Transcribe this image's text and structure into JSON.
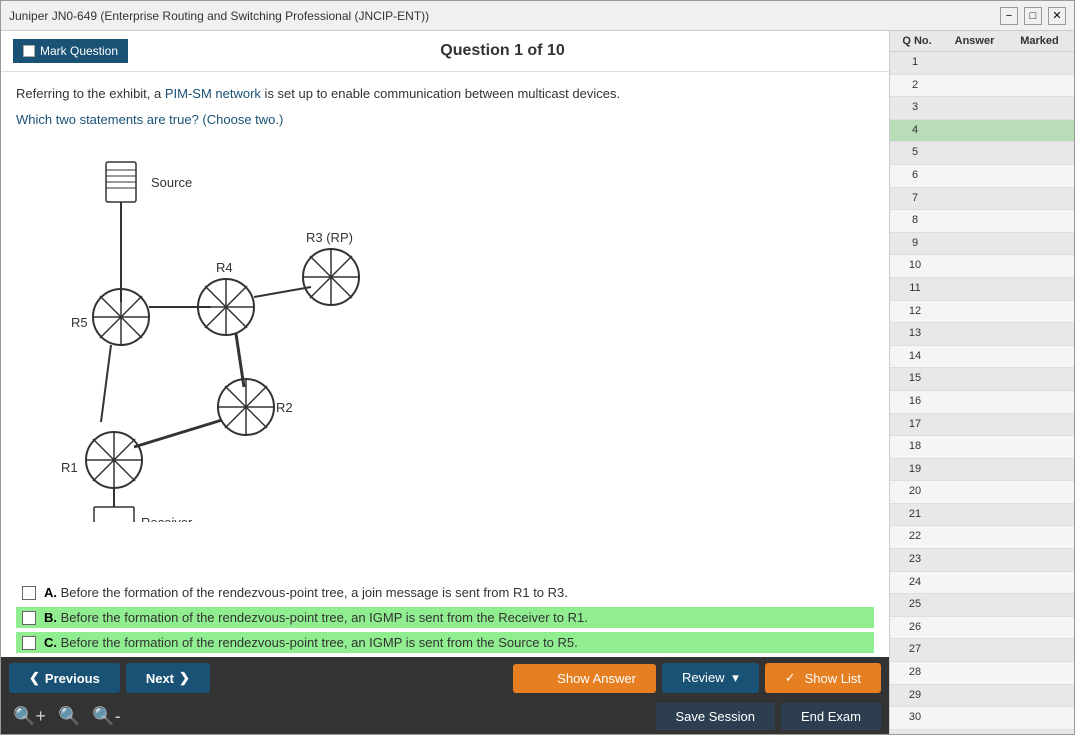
{
  "window": {
    "title": "Juniper JN0-649 (Enterprise Routing and Switching Professional (JNCIP-ENT))",
    "minimize_label": "−",
    "restore_label": "□",
    "close_label": "✕"
  },
  "header": {
    "mark_question_label": "Mark Question",
    "question_title": "Question 1 of 10"
  },
  "question": {
    "text_part1": "Referring to the exhibit, a ",
    "text_link": "PIM-SM network",
    "text_part2": " is set up to enable communication between multicast devices.",
    "choose_text": "Which two statements are true? (Choose two.)"
  },
  "answers": [
    {
      "id": "A",
      "label": "A.",
      "text": " Before the formation of the rendezvous-point tree, a join message is sent from R1 to R3.",
      "highlighted": false
    },
    {
      "id": "B",
      "label": "B.",
      "text": " Before the formation of the rendezvous-point tree, an IGMP is sent from the Receiver to R1.",
      "highlighted": true
    },
    {
      "id": "C",
      "label": "C.",
      "text": " Before the formation of the rendezvous-point tree, an IGMP is sent from the Source to R5.",
      "highlighted": true
    }
  ],
  "bottom_buttons": {
    "previous_label": "Previous",
    "next_label": "Next",
    "show_answer_label": "Show Answer",
    "review_label": "Review",
    "show_list_label": "Show List",
    "save_session_label": "Save Session",
    "end_exam_label": "End Exam"
  },
  "right_panel": {
    "col_q_no": "Q No.",
    "col_answer": "Answer",
    "col_marked": "Marked"
  },
  "questions_list": [
    {
      "num": 1,
      "answer": "",
      "marked": ""
    },
    {
      "num": 2,
      "answer": "",
      "marked": ""
    },
    {
      "num": 3,
      "answer": "",
      "marked": ""
    },
    {
      "num": 4,
      "answer": "",
      "marked": ""
    },
    {
      "num": 5,
      "answer": "",
      "marked": ""
    },
    {
      "num": 6,
      "answer": "",
      "marked": ""
    },
    {
      "num": 7,
      "answer": "",
      "marked": ""
    },
    {
      "num": 8,
      "answer": "",
      "marked": ""
    },
    {
      "num": 9,
      "answer": "",
      "marked": ""
    },
    {
      "num": 10,
      "answer": "",
      "marked": ""
    },
    {
      "num": 11,
      "answer": "",
      "marked": ""
    },
    {
      "num": 12,
      "answer": "",
      "marked": ""
    },
    {
      "num": 13,
      "answer": "",
      "marked": ""
    },
    {
      "num": 14,
      "answer": "",
      "marked": ""
    },
    {
      "num": 15,
      "answer": "",
      "marked": ""
    },
    {
      "num": 16,
      "answer": "",
      "marked": ""
    },
    {
      "num": 17,
      "answer": "",
      "marked": ""
    },
    {
      "num": 18,
      "answer": "",
      "marked": ""
    },
    {
      "num": 19,
      "answer": "",
      "marked": ""
    },
    {
      "num": 20,
      "answer": "",
      "marked": ""
    },
    {
      "num": 21,
      "answer": "",
      "marked": ""
    },
    {
      "num": 22,
      "answer": "",
      "marked": ""
    },
    {
      "num": 23,
      "answer": "",
      "marked": ""
    },
    {
      "num": 24,
      "answer": "",
      "marked": ""
    },
    {
      "num": 25,
      "answer": "",
      "marked": ""
    },
    {
      "num": 26,
      "answer": "",
      "marked": ""
    },
    {
      "num": 27,
      "answer": "",
      "marked": ""
    },
    {
      "num": 28,
      "answer": "",
      "marked": ""
    },
    {
      "num": 29,
      "answer": "",
      "marked": ""
    },
    {
      "num": 30,
      "answer": "",
      "marked": ""
    }
  ],
  "network": {
    "source_label": "Source",
    "r4_label": "R4",
    "r3_label": "R3 (RP)",
    "r5_label": "R5",
    "r2_label": "R2",
    "r1_label": "R1",
    "receiver_label": "Receiver"
  }
}
